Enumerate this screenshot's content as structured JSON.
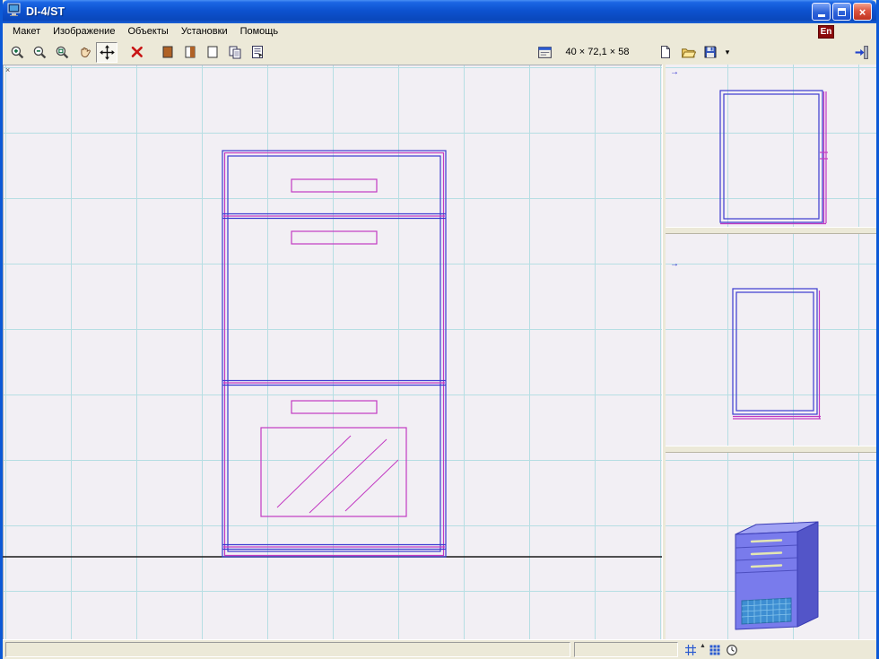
{
  "window": {
    "title": "DI-4/ST",
    "close_glyph": "×"
  },
  "menubar": {
    "items": [
      "Макет",
      "Изображение",
      "Объекты",
      "Установки",
      "Помощь"
    ],
    "language_indicator": "En"
  },
  "toolbar": {
    "dimensions_value": "40 × 72,1 × 58",
    "save_dropdown_glyph": "▾"
  },
  "statusbar": {
    "grid_up_glyph": "▲"
  },
  "canvas": {
    "origin_mark": "×",
    "side_panel_mark": "→",
    "front_panel_mark": "→"
  },
  "icons": {
    "zoom_in": "magnifier-plus",
    "zoom_out": "magnifier-minus",
    "zoom_fit": "magnifier-page",
    "pan": "hand",
    "move": "cross-arrows",
    "delete": "red-x",
    "fill_solid": "filled-rect",
    "fill_half": "half-filled-rect",
    "fill_none": "outline-rect",
    "copy": "two-sheets",
    "properties": "sheet-lines",
    "object_properties": "window-sheet",
    "new": "blank-page",
    "open": "folder",
    "save": "diskette",
    "exit": "exit-plug",
    "grid_toggle": "grid",
    "grid_snap": "grid-filled",
    "clock": "clock"
  },
  "colors": {
    "titlebar_blue": "#0d52cf",
    "toolbar_bg": "#ece9d8",
    "canvas_bg": "#f2eff4",
    "grid_line": "#b6dee3",
    "drawing_blue": "#3b3bd0",
    "drawing_magenta": "#c23ac2",
    "floor_line": "#1a1a1a",
    "lang_badge_bg": "#8b0a0a",
    "view3d_front": "#797bec",
    "view3d_side": "#5355c8",
    "view3d_top": "#a0a2f4",
    "view3d_vent": "#3e8ed2"
  }
}
